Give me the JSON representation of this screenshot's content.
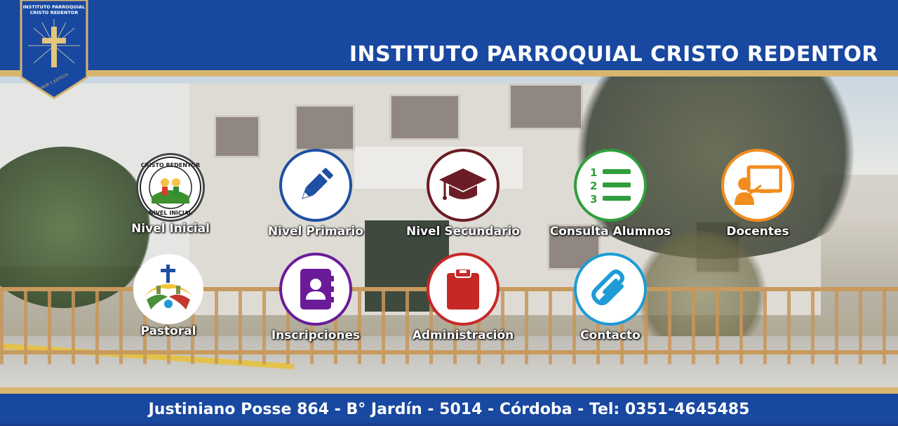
{
  "header": {
    "title": "INSTITUTO PARROQUIAL CRISTO REDENTOR",
    "logo": {
      "line1": "INSTITUTO PARROQUIAL",
      "line2": "CRISTO REDENTOR",
      "motto": "AMOR Y JUSTICIA"
    }
  },
  "menu": [
    {
      "label": "Nivel Inicial",
      "icon": "nivel-inicial-logo",
      "color": "#333333"
    },
    {
      "label": "Nivel Primario",
      "icon": "pencil-icon",
      "color": "#1e4fa2"
    },
    {
      "label": "Nivel Secundario",
      "icon": "graduation-cap-icon",
      "color": "#6b1c24"
    },
    {
      "label": "Consulta Alumnos",
      "icon": "numbered-list-icon",
      "color": "#2f9e3c"
    },
    {
      "label": "Docentes",
      "icon": "teacher-icon",
      "color": "#f28c1e"
    },
    {
      "label": "Pastoral",
      "icon": "pastoral-logo",
      "color": "#4a8f3a"
    },
    {
      "label": "Inscripciones",
      "icon": "contact-book-icon",
      "color": "#6a1b9a"
    },
    {
      "label": "Administración",
      "icon": "clipboard-icon",
      "color": "#c62828"
    },
    {
      "label": "Contacto",
      "icon": "paperclip-icon",
      "color": "#1e9bd6"
    }
  ],
  "nivel_inicial_logo": {
    "top": "CRISTO REDENTOR",
    "bottom": "NIVEL INICIAL"
  },
  "footer": {
    "text": "Justiniano Posse 864 - B° Jardín - 5014 - Córdoba - Tel: 0351-4645485"
  },
  "colors": {
    "brand_blue": "#1848a0",
    "gold": "#d8b56e"
  }
}
